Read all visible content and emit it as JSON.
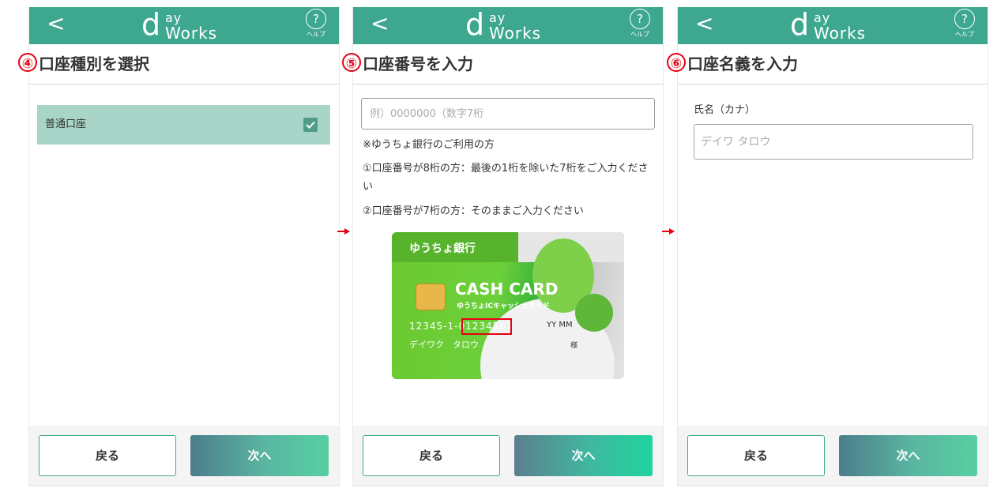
{
  "app": {
    "logo_mark": "d",
    "logo_ay": "ay",
    "logo_works": "Works",
    "help_label": "ヘルプ",
    "help_symbol": "?",
    "back_symbol": "<",
    "accent_color": "#3ea78f",
    "step_color": "#e60012"
  },
  "screens": [
    {
      "step_number": "④",
      "title": "口座種別を選択",
      "option_label": "普通口座",
      "option_checked": true,
      "back_button": "戻る",
      "next_button": "次へ"
    },
    {
      "step_number": "⑤",
      "title": "口座番号を入力",
      "input_placeholder": "例）0000000（数字7桁",
      "note_heading": "※ゆうちょ銀行のご利用の方",
      "note_1": "①口座番号が8桁の方：最後の1桁を除いた7桁をご入力ください",
      "note_2": "②口座番号が7桁の方：そのままご入力ください",
      "card": {
        "bank_name": "ゆうちょ銀行",
        "cash_card": "CASH CARD",
        "subtitle": "ゆうちょICキャッシュカード",
        "number": "12345-1-01234567",
        "name": "デイワク　タロウ",
        "expiry": "YY MM",
        "honorific": "様"
      },
      "back_button": "戻る",
      "next_button": "次へ"
    },
    {
      "step_number": "⑥",
      "title": "口座名義を入力",
      "field_label": "氏名（カナ）",
      "input_placeholder": "デイワ タロウ",
      "back_button": "戻る",
      "next_button": "次へ"
    }
  ]
}
